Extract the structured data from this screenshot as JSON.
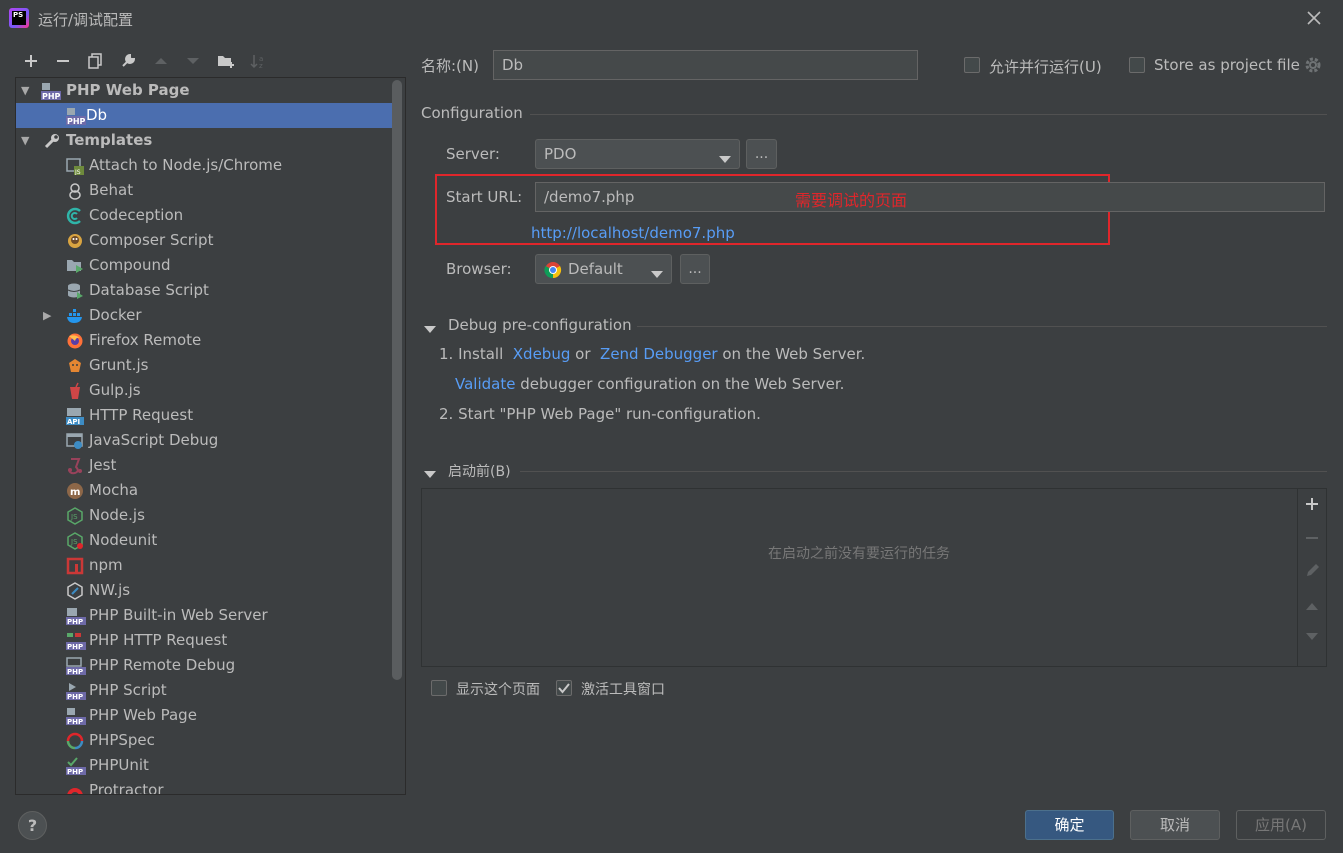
{
  "window": {
    "title": "运行/调试配置",
    "app_icon_text": "PS"
  },
  "tree": {
    "items": [
      {
        "label": "PHP Web Page",
        "bold": true,
        "expanded": true,
        "level": 0
      },
      {
        "label": "Db",
        "selected": true,
        "level": 1
      },
      {
        "label": "Templates",
        "bold": true,
        "expanded": true,
        "level": 0
      },
      {
        "label": "Attach to Node.js/Chrome",
        "level": 1
      },
      {
        "label": "Behat",
        "level": 1
      },
      {
        "label": "Codeception",
        "level": 1
      },
      {
        "label": "Composer Script",
        "level": 1
      },
      {
        "label": "Compound",
        "level": 1
      },
      {
        "label": "Database Script",
        "level": 1
      },
      {
        "label": "Docker",
        "level": 1,
        "collapsed": true
      },
      {
        "label": "Firefox Remote",
        "level": 1
      },
      {
        "label": "Grunt.js",
        "level": 1
      },
      {
        "label": "Gulp.js",
        "level": 1
      },
      {
        "label": "HTTP Request",
        "level": 1
      },
      {
        "label": "JavaScript Debug",
        "level": 1
      },
      {
        "label": "Jest",
        "level": 1
      },
      {
        "label": "Mocha",
        "level": 1
      },
      {
        "label": "Node.js",
        "level": 1
      },
      {
        "label": "Nodeunit",
        "level": 1
      },
      {
        "label": "npm",
        "level": 1
      },
      {
        "label": "NW.js",
        "level": 1
      },
      {
        "label": "PHP Built-in Web Server",
        "level": 1
      },
      {
        "label": "PHP HTTP Request",
        "level": 1
      },
      {
        "label": "PHP Remote Debug",
        "level": 1
      },
      {
        "label": "PHP Script",
        "level": 1
      },
      {
        "label": "PHP Web Page",
        "level": 1
      },
      {
        "label": "PHPSpec",
        "level": 1
      },
      {
        "label": "PHPUnit",
        "level": 1
      },
      {
        "label": "Protractor",
        "level": 1
      }
    ]
  },
  "form": {
    "name_label": "名称:(N)",
    "name_value": "Db",
    "allow_parallel_label": "允许并行运行(U)",
    "store_project_label": "Store as project file",
    "configuration_header": "Configuration",
    "server_label": "Server:",
    "server_value": "PDO",
    "dots": "...",
    "start_url_label": "Start URL:",
    "start_url_value": "/demo7.php",
    "annotation": "需要调试的页面",
    "resolved_url": "http://localhost/demo7.php",
    "browser_label": "Browser:",
    "browser_value": "Default"
  },
  "debug_pre": {
    "header": "Debug pre-configuration",
    "step1_prefix": "1. Install",
    "xdebug": "Xdebug",
    "or": "or",
    "zend": "Zend Debugger",
    "step1_suffix": "on the Web Server.",
    "validate": "Validate",
    "validate_suffix": "debugger configuration on the Web Server.",
    "step2": "2. Start \"PHP Web Page\" run-configuration."
  },
  "before_launch": {
    "header": "启动前(B)",
    "empty_text": "在启动之前没有要运行的任务",
    "show_page_label": "显示这个页面",
    "activate_tool_label": "激活工具窗口",
    "activate_tool_checked": true
  },
  "buttons": {
    "ok": "确定",
    "cancel": "取消",
    "apply": "应用(A)",
    "help": "?"
  },
  "colors": {
    "background": "#3c3f41",
    "selection": "#4b6eaf",
    "link": "#589df6",
    "annotation_red": "#e0262b"
  }
}
